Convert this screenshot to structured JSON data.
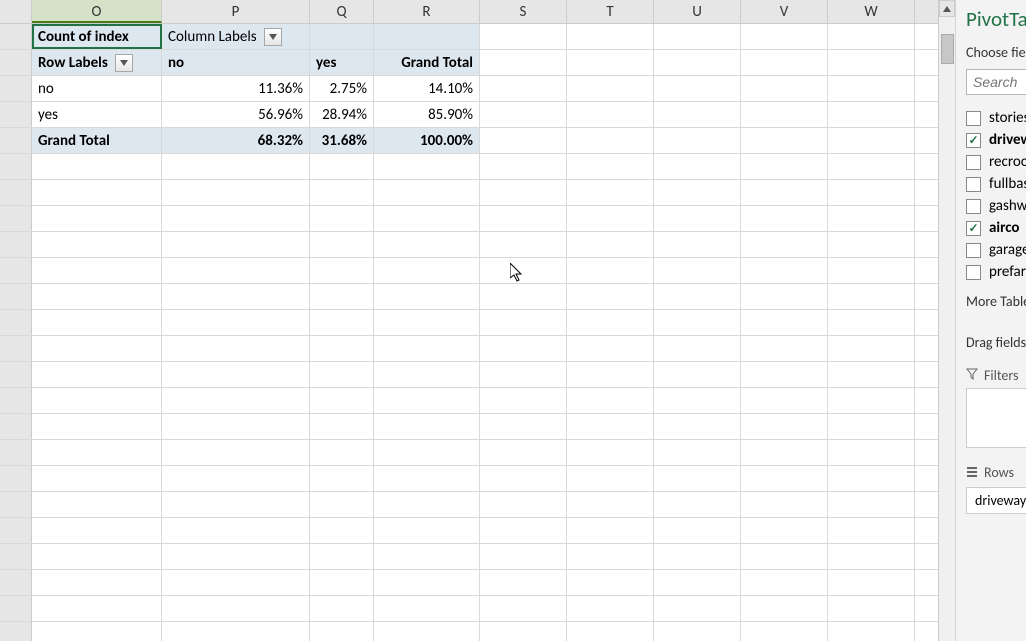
{
  "columns": [
    "O",
    "P",
    "Q",
    "R",
    "S",
    "T",
    "U",
    "V",
    "W"
  ],
  "pivot": {
    "count_label": "Count of index",
    "column_labels": "Column Labels",
    "row_labels": "Row Labels",
    "col_no": "no",
    "col_yes": "yes",
    "col_grand": "Grand Total",
    "rows": [
      {
        "label": "no",
        "no": "11.36%",
        "yes": "2.75%",
        "total": "14.10%"
      },
      {
        "label": "yes",
        "no": "56.96%",
        "yes": "28.94%",
        "total": "85.90%"
      }
    ],
    "grand_total_label": "Grand Total",
    "grand": {
      "no": "68.32%",
      "yes": "31.68%",
      "total": "100.00%"
    }
  },
  "panel": {
    "title": "PivotTable Fields",
    "choose": "Choose fields to add to report:",
    "search_placeholder": "Search",
    "fields": [
      {
        "name": "stories",
        "checked": false
      },
      {
        "name": "driveway",
        "checked": true
      },
      {
        "name": "recroom",
        "checked": false
      },
      {
        "name": "fullbase",
        "checked": false
      },
      {
        "name": "gashw",
        "checked": false
      },
      {
        "name": "airco",
        "checked": true
      },
      {
        "name": "garagepl",
        "checked": false
      },
      {
        "name": "prefarea",
        "checked": false
      }
    ],
    "more_tables": "More Tables...",
    "drag_label": "Drag fields between areas below:",
    "filters_label": "Filters",
    "rows_label": "Rows",
    "row_chip": "driveway"
  }
}
